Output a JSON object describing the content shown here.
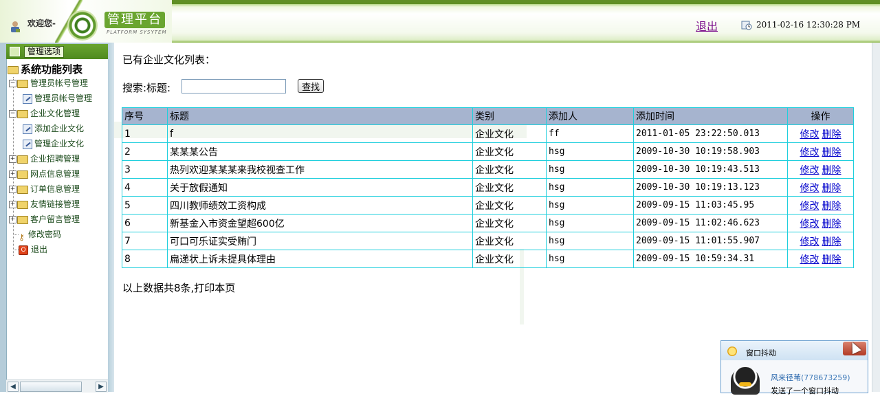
{
  "header": {
    "welcome": "欢迎您-",
    "logo_title": "管理平台",
    "logo_subtitle": "PLATFORM SYSYTEM",
    "logout": "退出",
    "datetime": "2011-02-16 12:30:28 PM"
  },
  "sidebar": {
    "header_label": "管理选项",
    "root": "系统功能列表",
    "items": [
      {
        "label": "管理员帐号管理",
        "expanded": true
      },
      {
        "label": "管理员帐号管理"
      },
      {
        "label": "企业文化管理",
        "expanded": true
      },
      {
        "label": "添加企业文化"
      },
      {
        "label": "管理企业文化"
      },
      {
        "label": "企业招聘管理",
        "expanded": false
      },
      {
        "label": "网点信息管理",
        "expanded": false
      },
      {
        "label": "订单信息管理",
        "expanded": false
      },
      {
        "label": "友情链接管理",
        "expanded": false
      },
      {
        "label": "客户留言管理",
        "expanded": false
      },
      {
        "label": "修改密码"
      },
      {
        "label": "退出"
      }
    ]
  },
  "main": {
    "list_title": "已有企业文化列表：",
    "search_label": "搜索:标题:",
    "search_value": "",
    "search_button": "查找",
    "columns": [
      "序号",
      "标题",
      "类别",
      "添加人",
      "添加时间",
      "操作"
    ],
    "rows": [
      {
        "no": "1",
        "title": "f",
        "category": "企业文化",
        "adder": "ff",
        "time": "2011-01-05 23:22:50.013"
      },
      {
        "no": "2",
        "title": "某某某公告",
        "category": "企业文化",
        "adder": "hsg",
        "time": "2009-10-30 10:19:58.903"
      },
      {
        "no": "3",
        "title": "热列欢迎某某某来我校视查工作",
        "category": "企业文化",
        "adder": "hsg",
        "time": "2009-10-30 10:19:43.513"
      },
      {
        "no": "4",
        "title": "关于放假通知",
        "category": "企业文化",
        "adder": "hsg",
        "time": "2009-10-30 10:19:13.123"
      },
      {
        "no": "5",
        "title": "四川教师绩效工资构成",
        "category": "企业文化",
        "adder": "hsg",
        "time": "2009-09-15 11:03:45.95"
      },
      {
        "no": "6",
        "title": "新基金入市资金望超600亿",
        "category": "企业文化",
        "adder": "hsg",
        "time": "2009-09-15 11:02:46.623"
      },
      {
        "no": "7",
        "title": "可口可乐证实受贿门",
        "category": "企业文化",
        "adder": "hsg",
        "time": "2009-09-15 11:01:55.907"
      },
      {
        "no": "8",
        "title": "扁递状上诉未提具体理由",
        "category": "企业文化",
        "adder": "hsg",
        "time": "2009-09-15 10:59:34.31"
      }
    ],
    "edit_label": "修改",
    "delete_label": "删除",
    "footer": "以上数据共8条,打印本页"
  },
  "popup": {
    "title": "窗口抖动",
    "sender": "风来径苇",
    "qq_number": "(778673259)",
    "message": "发送了一个窗口抖动"
  }
}
